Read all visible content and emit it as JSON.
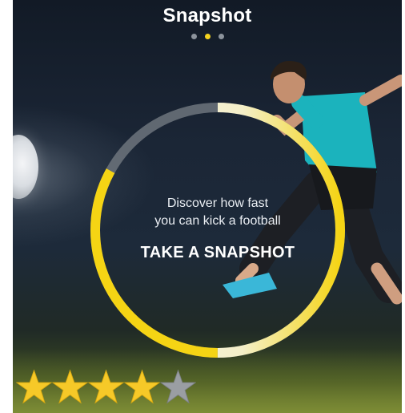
{
  "header": {
    "title": "Snapshot"
  },
  "pager": {
    "count": 3,
    "active_index": 1
  },
  "main": {
    "prompt_line1": "Discover how fast",
    "prompt_line2": "you can kick a football",
    "cta_label": "TAKE A SNAPSHOT"
  },
  "rating": {
    "value": 4,
    "max": 5
  },
  "progress_ring": {
    "filled_fraction": 0.83
  },
  "colors": {
    "accent_yellow": "#f5d414",
    "ring_white": "#f2f2f2",
    "ring_grey": "#6d747c",
    "star_gold": "#f6c928",
    "star_grey": "#9a9ea3"
  }
}
